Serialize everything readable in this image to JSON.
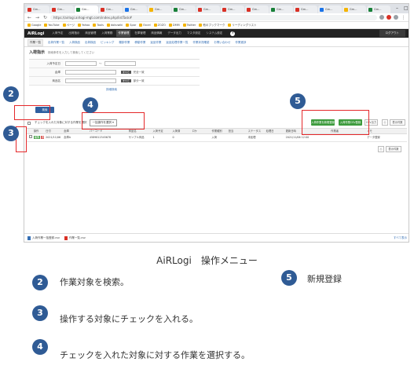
{
  "browser": {
    "tabs": [
      "Gm...",
      "Gm...",
      "Gm...",
      "Gm...",
      "Gm...",
      "Gm...",
      "Gm...",
      "Gm...",
      "Gm...",
      "Gm...",
      "Gm...",
      "Gm...",
      "Gm...",
      "Gm...",
      "Gm..."
    ],
    "url": "https://airlogi.airlogi-mgt.com/index.php/listTask#",
    "bookmarks": [
      "Google",
      "YouTube",
      "ページ",
      "Yahoo",
      "Tools",
      "dokuwiki",
      "Spar",
      "Excel",
      "ZOZO",
      "DMM",
      "Twitter",
      "他のブックマーク",
      "リーディングリスト"
    ]
  },
  "app": {
    "logo": "AiRLogi",
    "menu": [
      "入荷予定",
      "出荷指示",
      "商品管理",
      "入荷業務",
      "作業管理",
      "在庫管理",
      "商品情報",
      "データ出力",
      "マスタ設定",
      "システム設定"
    ],
    "active_menu_index": 4,
    "help": "?",
    "user": "ログアウト",
    "subtabs": [
      "作業一覧",
      "出荷作業一覧",
      "入荷検品",
      "出荷検品",
      "ピッキング",
      "棚卸作業",
      "移動作業",
      "返品作業",
      "返品処理作業一覧",
      "作業状況確認",
      "お問い合わせ",
      "作業進捗"
    ],
    "page_title": "入荷指示",
    "page_subtitle": "検索条件を入力して検索してください",
    "form": {
      "rows": [
        {
          "label": "入荷予定日",
          "text": "〜"
        },
        {
          "label": "倉庫",
          "tag": "すべて",
          "text": "完全一致"
        },
        {
          "label": "商品名",
          "tag": "すべて",
          "text": "部分一致"
        }
      ],
      "link": "詳細検索"
    },
    "search_label": "検索",
    "ops_text": "チェックを入れた対象に対する作業を選択",
    "ops_select": "一括操作を選択",
    "green_buttons": [
      "入荷作業を新規登録",
      "入荷作業CSV登録"
    ],
    "white_buttons": [
      "CSV出力",
      "表示件数"
    ],
    "columns": [
      "",
      "操作",
      "日付",
      "倉庫",
      "バーコード",
      "商品名",
      "入荷予定",
      "入荷済",
      "ロケ",
      "作業種別",
      "担当",
      "ステータス",
      "処理日",
      "更新日時",
      "作業者",
      "メモ"
    ],
    "row": [
      "",
      "",
      "2021/11/06",
      "倉庫A",
      "4589812345678",
      "サンプル商品",
      "1",
      "0",
      "",
      "入荷",
      "",
      "未処理",
      "",
      "2021/11/06 12:00",
      "",
      "データ登録"
    ],
    "row_actions": [
      "編集",
      "削除"
    ]
  },
  "downloads": {
    "items": [
      "入荷作業一括登録.csv",
      "作業一覧.csv"
    ],
    "show_all": "すべて表示"
  },
  "callouts": [
    "2",
    "3",
    "4",
    "5"
  ],
  "caption": {
    "title": "AiRLogi　操作メニュー",
    "items": [
      {
        "num": "2",
        "text": "作業対象を検索。"
      },
      {
        "num": "3",
        "text": "操作する対象にチェックを入れる。"
      },
      {
        "num": "4",
        "text": "チェックを入れた対象に対する作業を選択する。"
      },
      {
        "num": "5",
        "text": "新規登録"
      }
    ]
  },
  "colors": {
    "callout_red": "#e5282a",
    "marker_blue": "#2f5b95",
    "green": "#3d9b3d",
    "nav_dark": "#222222"
  }
}
